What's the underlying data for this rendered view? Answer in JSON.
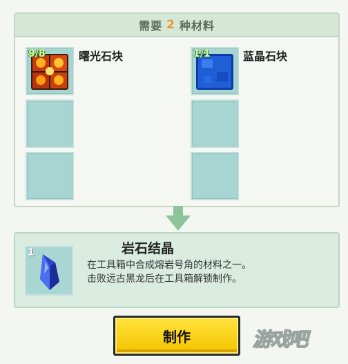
{
  "header": {
    "prefix": "需要",
    "count": "2",
    "suffix": "种材料"
  },
  "materials": [
    {
      "name": "曙光石块",
      "count": "9/8",
      "icon": "lava-block-icon"
    },
    {
      "name": "蓝晶石块",
      "count": "1/1",
      "icon": "blue-crystal-block-icon"
    }
  ],
  "result": {
    "name": "岩石结晶",
    "count": "1",
    "icon": "rock-crystal-icon",
    "desc_line1": "在工具箱中合成熔岩号角的材料之一。",
    "desc_line2": "击败远古黑龙后在工具箱解锁制作。"
  },
  "craft_button": "制作",
  "watermark": "游戏吧",
  "colors": {
    "accent_number": "#f0962c",
    "button": "#f4c400",
    "slot": "#a7d5d2"
  }
}
